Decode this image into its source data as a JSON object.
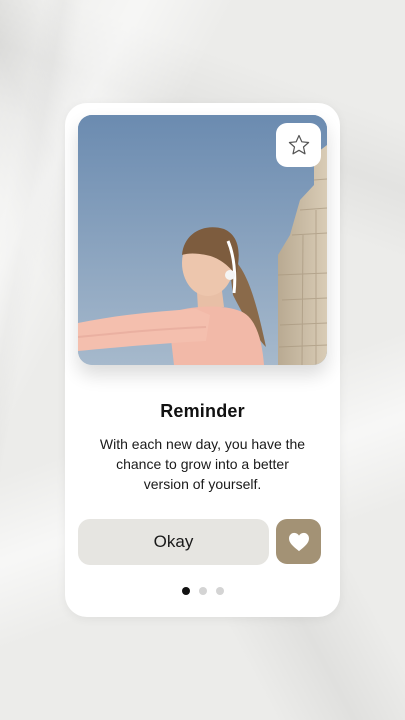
{
  "card": {
    "title": "Reminder",
    "message": "With each new day, you have the chance to grow into a better version of yourself.",
    "primary_button": "Okay",
    "icons": {
      "favorite": "star-icon",
      "like": "heart-icon"
    },
    "pagination": {
      "total": 3,
      "active_index": 1
    },
    "colors": {
      "like_button": "#a39275",
      "okay_button": "#e6e5e1",
      "active_dot": "#111111",
      "inactive_dot": "#d4d4d4"
    }
  }
}
